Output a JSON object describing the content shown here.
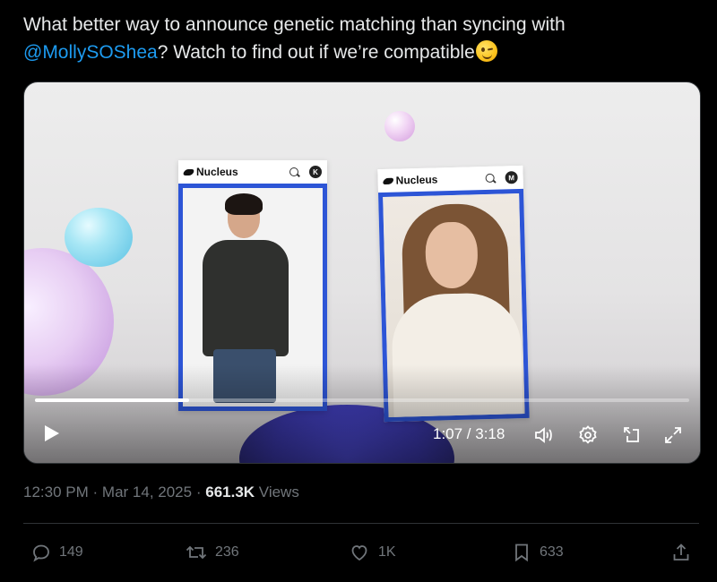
{
  "tweet": {
    "text_before": "What better way to announce genetic matching than syncing with ",
    "mention": "@MollySOShea",
    "text_after": "? Watch to find out if we’re compatible"
  },
  "video": {
    "cards": [
      {
        "brand": "Nucleus",
        "avatar_initial": "K"
      },
      {
        "brand": "Nucleus",
        "avatar_initial": "M"
      }
    ],
    "time_display": "1:07 / 3:18",
    "progress_fraction": 0.235
  },
  "meta": {
    "time": "12:30 PM",
    "separator": "·",
    "date": "Mar 14, 2025",
    "views_count": "661.3K",
    "views_label": "Views"
  },
  "actions": {
    "replies": "149",
    "reposts": "236",
    "likes": "1K",
    "bookmarks": "633"
  }
}
